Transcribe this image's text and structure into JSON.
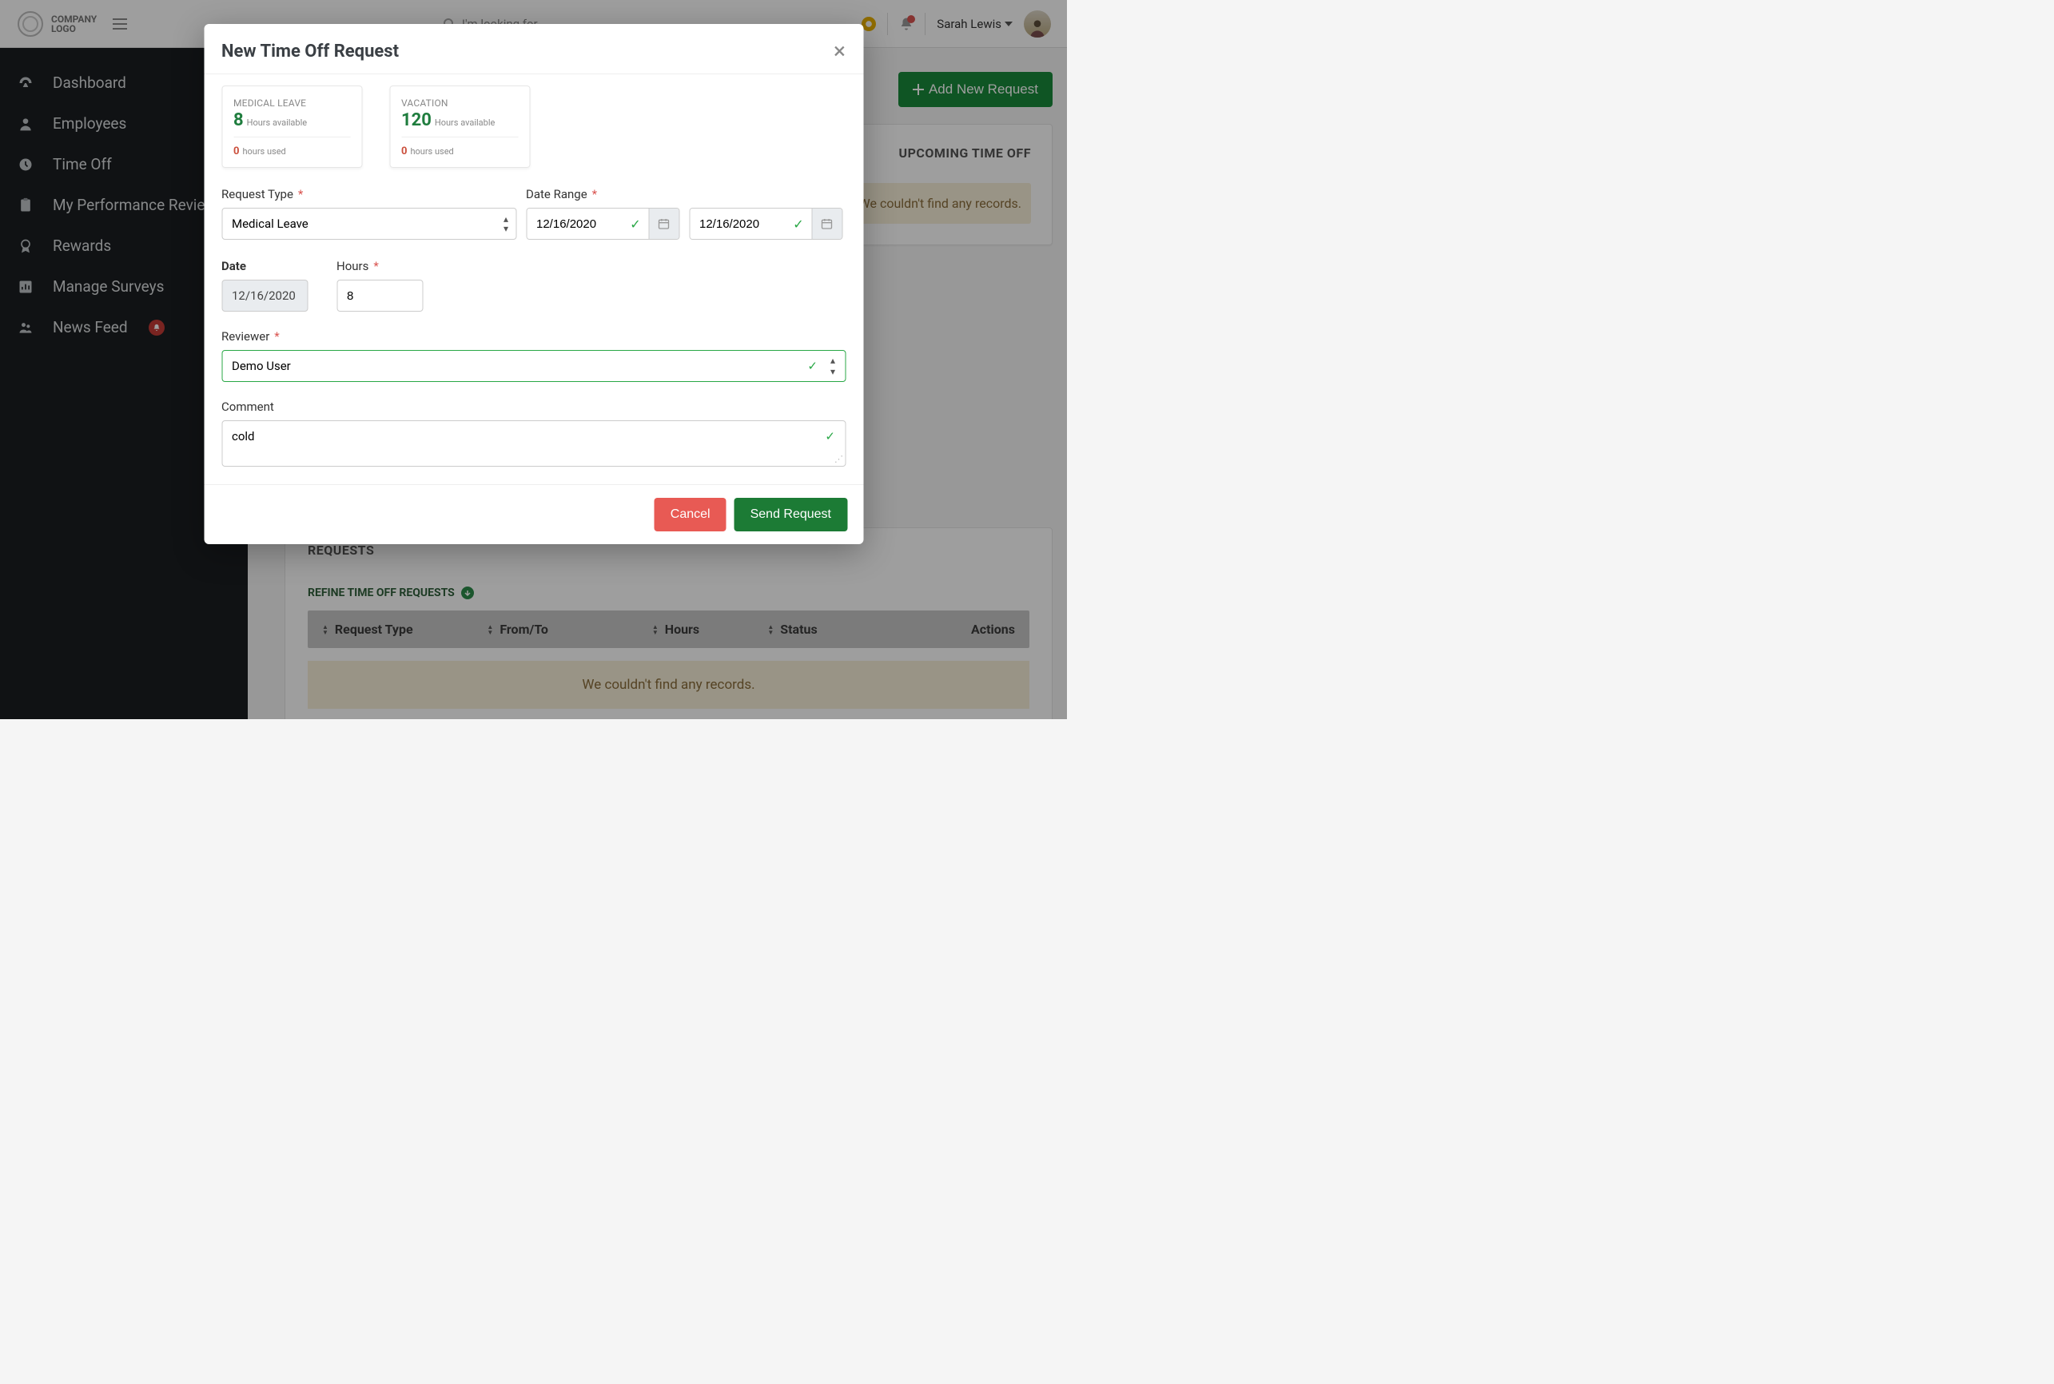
{
  "header": {
    "logo_text": "COMPANY\nLOGO",
    "search_placeholder": "I'm looking for...",
    "user_name": "Sarah Lewis"
  },
  "sidebar": {
    "items": [
      {
        "label": "Dashboard",
        "icon": "dashboard"
      },
      {
        "label": "Employees",
        "icon": "user"
      },
      {
        "label": "Time Off",
        "icon": "clock"
      },
      {
        "label": "My Performance Reviews",
        "icon": "clipboard"
      },
      {
        "label": "Rewards",
        "icon": "badge"
      },
      {
        "label": "Manage Surveys",
        "icon": "chart"
      },
      {
        "label": "News Feed",
        "icon": "people",
        "badge": true
      }
    ]
  },
  "main": {
    "add_button": "Add New Request",
    "upcoming_title": "UPCOMING TIME OFF",
    "upcoming_msg": "We couldn't find any records.",
    "requests_title": "REQUESTS",
    "refine_label": "REFINE TIME OFF REQUESTS",
    "columns": {
      "request_type": "Request Type",
      "from_to": "From/To",
      "hours": "Hours",
      "status": "Status",
      "actions": "Actions"
    },
    "no_records": "We couldn't find any records."
  },
  "modal": {
    "title": "New Time Off Request",
    "balances": [
      {
        "name": "MEDICAL LEAVE",
        "hours": "8",
        "available_label": "Hours available",
        "used": "0",
        "used_label": "hours used"
      },
      {
        "name": "VACATION",
        "hours": "120",
        "available_label": "Hours available",
        "used": "0",
        "used_label": "hours used"
      }
    ],
    "labels": {
      "request_type": "Request Type",
      "date_range": "Date Range",
      "date": "Date",
      "hours": "Hours",
      "reviewer": "Reviewer",
      "comment": "Comment"
    },
    "values": {
      "request_type": "Medical Leave",
      "date_from": "12/16/2020",
      "date_to": "12/16/2020",
      "date": "12/16/2020",
      "hours": "8",
      "reviewer": "Demo User",
      "comment": "cold"
    },
    "buttons": {
      "cancel": "Cancel",
      "send": "Send Request"
    }
  }
}
